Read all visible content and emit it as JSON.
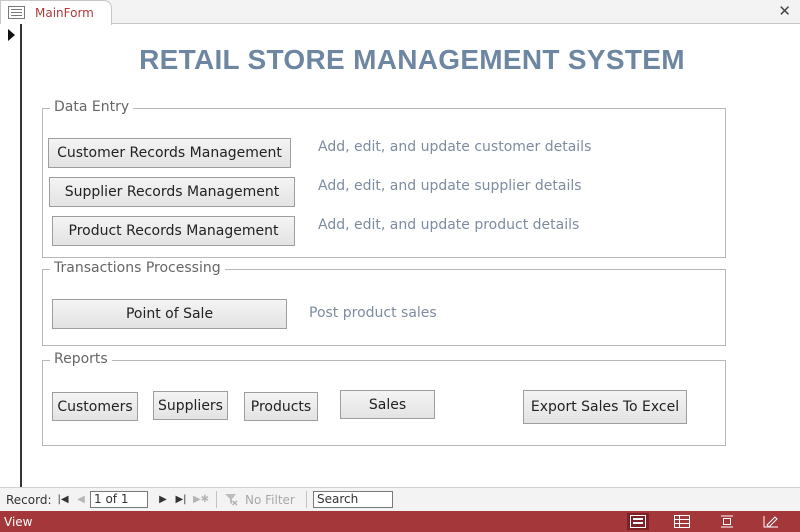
{
  "tab": {
    "label": "MainForm",
    "close_glyph": "✕"
  },
  "title": "RETAIL STORE MANAGEMENT SYSTEM",
  "groups": {
    "data_entry": {
      "label": "Data Entry",
      "customer_btn": "Customer Records Management",
      "customer_desc": "Add, edit, and update customer details",
      "supplier_btn": "Supplier Records Management",
      "supplier_desc": "Add, edit, and update supplier details",
      "product_btn": "Product Records Management",
      "product_desc": "Add, edit, and update product details"
    },
    "transactions": {
      "label": "Transactions Processing",
      "pos_btn": "Point of Sale",
      "pos_desc": "Post product sales"
    },
    "reports": {
      "label": "Reports",
      "customers_btn": "Customers",
      "suppliers_btn": "Suppliers",
      "products_btn": "Products",
      "sales_btn": "Sales",
      "export_btn": "Export Sales To Excel"
    }
  },
  "navbar": {
    "record_label": "Record:",
    "record_value": "1 of 1",
    "filter_label": "No Filter",
    "search_value": "Search"
  },
  "status": {
    "text": "View"
  },
  "icons": [
    "form-icon",
    "close-icon",
    "record-selector-arrow-icon",
    "first-record-icon",
    "previous-record-icon",
    "next-record-icon",
    "last-record-icon",
    "new-record-icon",
    "filter-icon",
    "form-view-icon",
    "datasheet-view-icon",
    "layout-view-icon",
    "design-view-icon"
  ],
  "colors": {
    "title": "#6d87a3",
    "tab_label": "#b03a3a",
    "status_bar": "#a4373a",
    "description": "#7d8ca0"
  }
}
